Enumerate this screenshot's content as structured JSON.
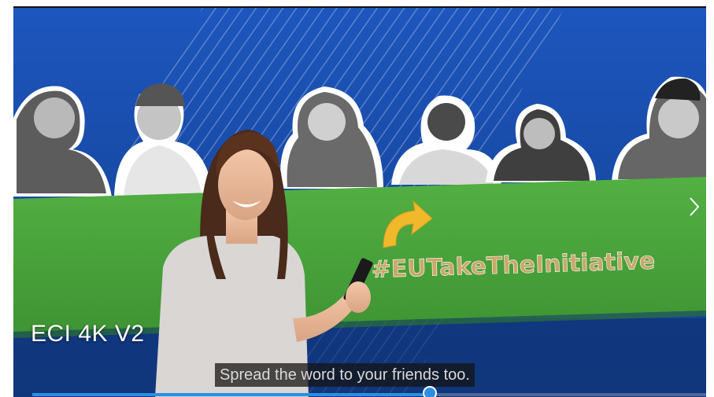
{
  "video": {
    "title": "ECI 4K V2",
    "banner_hashtag": "#EUTakeTheInitiative",
    "caption": "Spread the word to your friends too.",
    "progress_fraction": 0.59
  },
  "controls": {
    "next_icon": "chevron-right-icon"
  },
  "colors": {
    "background_blue": "#1b4fb0",
    "banner_green": "#4aa43a",
    "arrow_yellow": "#f0b92b",
    "progress_blue": "#2c8fe0"
  }
}
